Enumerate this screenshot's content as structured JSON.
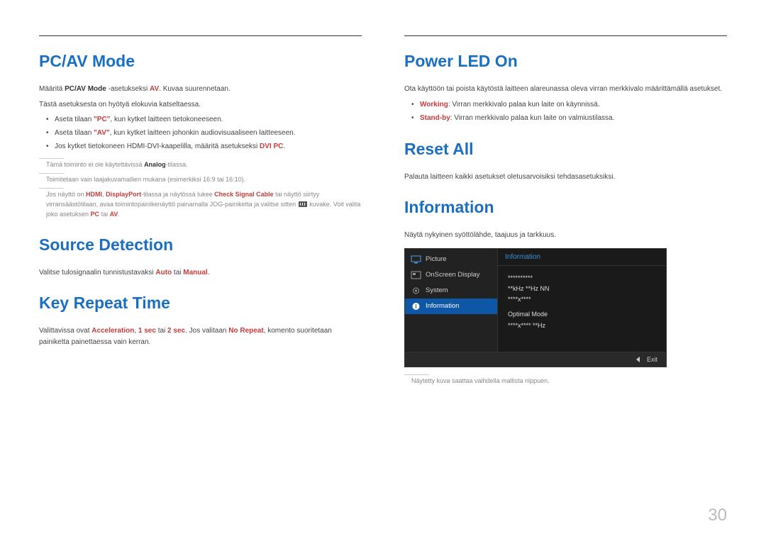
{
  "page_number": "30",
  "left": {
    "section1": {
      "title": "PC/AV Mode",
      "p1_pre": "Määritä ",
      "p1_bold": "PC/AV Mode",
      "p1_mid": " -asetukseksi ",
      "p1_accent": "AV",
      "p1_post": ". Kuvaa suurennetaan.",
      "p2": "Tästä asetuksesta on hyötyä elokuvia katseltaessa.",
      "b1_pre": "Aseta tilaan ",
      "b1_accent": "\"PC\"",
      "b1_post": ", kun kytket laitteen tietokoneeseen.",
      "b2_pre": "Aseta tilaan ",
      "b2_accent": "\"AV\"",
      "b2_post": ", kun kytket laitteen johonkin audiovisuaaliseen laitteeseen.",
      "b3_pre": "Jos kytket tietokoneen HDMI-DVI-kaapelilla, määritä asetukseksi ",
      "b3_accent": "DVI PC",
      "b3_post": ".",
      "fn1_pre": "Tämä toiminto ei ole käytettävissä ",
      "fn1_bold": "Analog",
      "fn1_post": "-tilassa.",
      "fn2": "Toimitetaan vain laajakuvamallien mukana (esimerkiksi 16:9 tai 16:10).",
      "fn3_a": "Jos näyttö on ",
      "fn3_b": "HDMI",
      "fn3_c": ", ",
      "fn3_d": "DisplayPort",
      "fn3_e": "-tilassa ja näytössä lukee ",
      "fn3_f": "Check Signal Cable",
      "fn3_g": " tai näyttö siirtyy virransäästötilaan, avaa toimintopainikenäyttö painamalla JOG-painiketta ja valitse sitten ",
      "fn3_h": " kuvake. Voit valita joko asetuksen ",
      "fn3_i": "PC",
      "fn3_j": " tai ",
      "fn3_k": "AV",
      "fn3_l": "."
    },
    "section2": {
      "title": "Source Detection",
      "p_pre": "Valitse tulosignaalin tunnistustavaksi ",
      "p_a1": "Auto",
      "p_mid": " tai ",
      "p_a2": "Manual",
      "p_post": "."
    },
    "section3": {
      "title": "Key Repeat Time",
      "p_pre": "Valittavissa ovat ",
      "p_a1": "Acceleration",
      "p_c1": ", ",
      "p_a2": "1 sec",
      "p_c2": " tai ",
      "p_a3": "2 sec",
      "p_c3": ". Jos valitaan ",
      "p_a4": "No Repeat",
      "p_post": ", komento suoritetaan painiketta painettaessa vain kerran."
    }
  },
  "right": {
    "section1": {
      "title": "Power LED On",
      "p1": "Ota käyttöön tai poista käytöstä laitteen alareunassa oleva virran merkkivalo määrittämällä asetukset.",
      "b1_accent": "Working",
      "b1_post": ": Virran merkkivalo palaa kun laite on käynnissä.",
      "b2_accent": "Stand-by",
      "b2_post": ": Virran merkkivalo palaa kun laite on valmiustilassa."
    },
    "section2": {
      "title": "Reset All",
      "p1": "Palauta laitteen kaikki asetukset oletusarvoisiksi tehdasasetuksiksi."
    },
    "section3": {
      "title": "Information",
      "p1": "Näytä nykyinen syöttölähde, taajuus ja tarkkuus.",
      "osd": {
        "menu": {
          "picture": "Picture",
          "osd": "OnScreen Display",
          "system": "System",
          "information": "Information"
        },
        "panel_title": "Information",
        "line1": "**********",
        "line2": "**kHz **Hz NN",
        "line3": "****x****",
        "line4": "Optimal Mode",
        "line5": "****x**** **Hz",
        "exit": "Exit"
      },
      "fn": "Näytetty kuva saattaa vaihdella mallista riippuen."
    }
  }
}
